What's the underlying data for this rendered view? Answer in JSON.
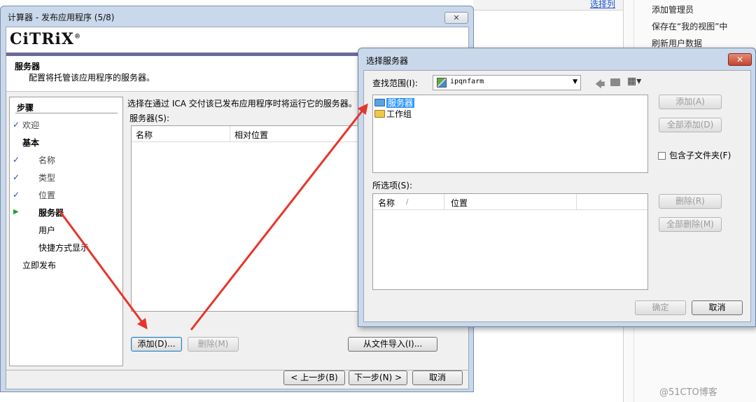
{
  "background": {
    "top_link": "选择列",
    "actions": [
      "添加管理员",
      "保存在“我的视图”中",
      "刷新用户数据"
    ],
    "watermark": "@51CTO博客"
  },
  "wizard": {
    "title": "计算器 - 发布应用程序 (5/8)",
    "close_glyph": "✕",
    "logo": "CiTRiX",
    "logo_mark": "®",
    "heading": "服务器",
    "description": "配置将托管该应用程序的服务器。",
    "steps_title": "步骤",
    "steps": [
      {
        "label": "欢迎",
        "state": "done"
      },
      {
        "label": "基本",
        "state": "group"
      },
      {
        "label": "名称",
        "state": "done"
      },
      {
        "label": "类型",
        "state": "done"
      },
      {
        "label": "位置",
        "state": "done"
      },
      {
        "label": "服务器",
        "state": "current"
      },
      {
        "label": "用户",
        "state": "todo"
      },
      {
        "label": "快捷方式显示",
        "state": "todo"
      },
      {
        "label": "立即发布",
        "state": "group"
      }
    ],
    "check_glyph": "✓",
    "current_glyph": "▶",
    "instruction": "选择在通过 ICA 交付该已发布应用程序时将运行它的服务器。",
    "servers_label": "服务器(S):",
    "columns": [
      "名称",
      "相对位置"
    ],
    "add_button": "添加(D)...",
    "remove_button": "删除(M)",
    "import_button": "从文件导入(I)...",
    "back_button": "< 上一步(B)",
    "next_button": "下一步(N) >",
    "cancel_button": "取消"
  },
  "dialog": {
    "title": "选择服务器",
    "close_glyph": "✕",
    "look_in_label": "查找范围(I):",
    "look_in_value": "ipqnfarm",
    "dropdown_glyph": "▼",
    "back_glyph": "🡄",
    "view_glyph": "▦▾",
    "tree": [
      {
        "label": "服务器",
        "selected": true
      },
      {
        "label": "工作组",
        "selected": false
      }
    ],
    "add_button": "添加(A)",
    "add_all_button": "全部添加(D)",
    "include_subfolders": "包含子文件夹(F)",
    "selected_label": "所选项(S):",
    "columns": [
      "名称",
      "位置"
    ],
    "sort_glyph": "/",
    "remove_button": "删除(R)",
    "remove_all_button": "全部删除(M)",
    "ok_button": "确定",
    "cancel_button": "取消"
  }
}
